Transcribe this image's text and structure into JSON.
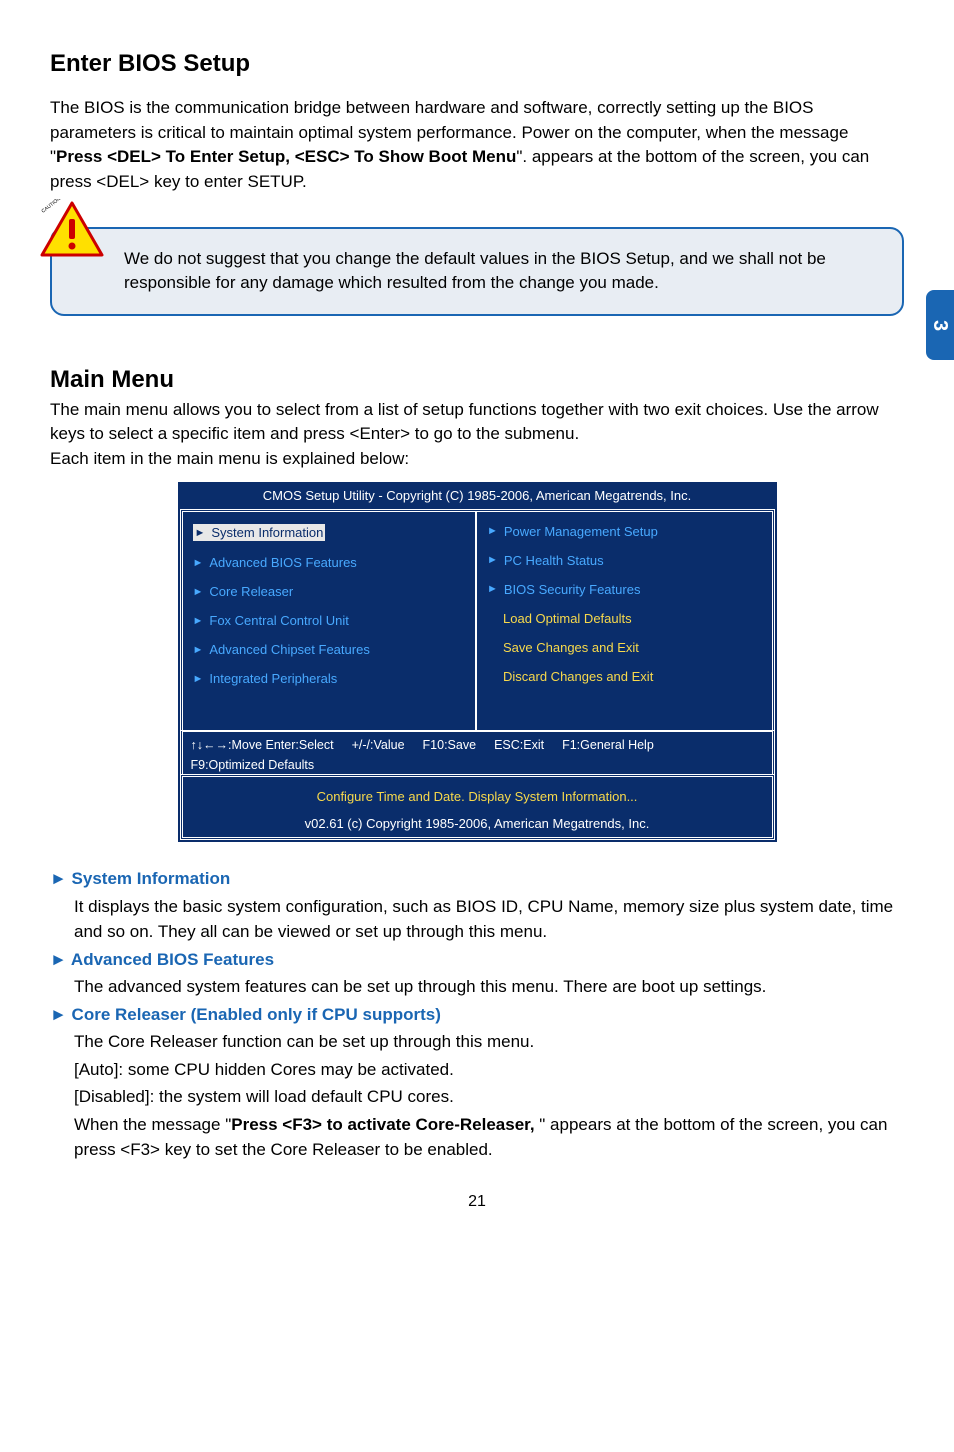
{
  "sideTab": "3",
  "section1": {
    "title": "Enter BIOS Setup",
    "para_a": "The BIOS is the communication bridge between hardware and software, correctly setting up the BIOS parameters is critical to maintain optimal system performance. Power on the computer, when the message \"",
    "para_bold": "Press <DEL> To Enter Setup, <ESC> To Show Boot Menu",
    "para_b": "\". appears at the bottom of the screen, you can press <DEL> key to enter SETUP."
  },
  "caution": {
    "label": "CAUTION",
    "text": "We do not suggest that you change the default values in the BIOS Setup, and we shall not be responsible for any damage which resulted from the change you made."
  },
  "section2": {
    "title": "Main Menu",
    "para": "The main menu allows you to select from a list of setup functions together with two exit choices. Use the arrow keys to select a specific item and press <Enter> to go to the submenu.\nEach item in the main menu is explained below:"
  },
  "bios": {
    "title": "CMOS Setup Utility - Copyright (C) 1985-2006, American Megatrends, Inc.",
    "left": [
      "System Information",
      "Advanced BIOS Features",
      "Core Releaser",
      "Fox Central Control Unit",
      "Advanced Chipset Features",
      "Integrated Peripherals"
    ],
    "right": [
      "Power Management Setup",
      "PC Health Status",
      "BIOS Security Features",
      "Load Optimal Defaults",
      "Save Changes and Exit",
      "Discard Changes and Exit"
    ],
    "hint_move": "↑↓←→:Move   Enter:Select",
    "hint_value": "+/-/:Value",
    "hint_save": "F10:Save",
    "hint_esc": "ESC:Exit",
    "hint_f1": "F1:General Help",
    "hint_f9": "F9:Optimized Defaults",
    "footer1": "Configure Time and Date.   Display System Information...",
    "footer2": "v02.61   (c) Copyright 1985-2006, American Megatrends, Inc."
  },
  "desc": {
    "h1": "► System Information",
    "p1": "It displays the basic system configuration, such as BIOS ID, CPU Name, memory size plus system date, time and so on. They all can be viewed or set up through this menu.",
    "h2": "► Advanced BIOS Features",
    "p2": "The advanced system features can be set up through this menu. There are boot up settings.",
    "h3": "► Core Releaser (Enabled only if CPU supports)",
    "p3a": "The Core Releaser function can be set up through this menu.",
    "p3b": "[Auto]: some CPU hidden Cores may be activated.",
    "p3c": "[Disabled]: the system will load default CPU cores.",
    "p3d_a": "When the message \"",
    "p3d_bold": "Press <F3> to activate Core-Releaser, ",
    "p3d_b": "\"   appears at the bottom of the screen, you can press <F3> key to set the Core Releaser to be enabled."
  },
  "pageNum": "21"
}
